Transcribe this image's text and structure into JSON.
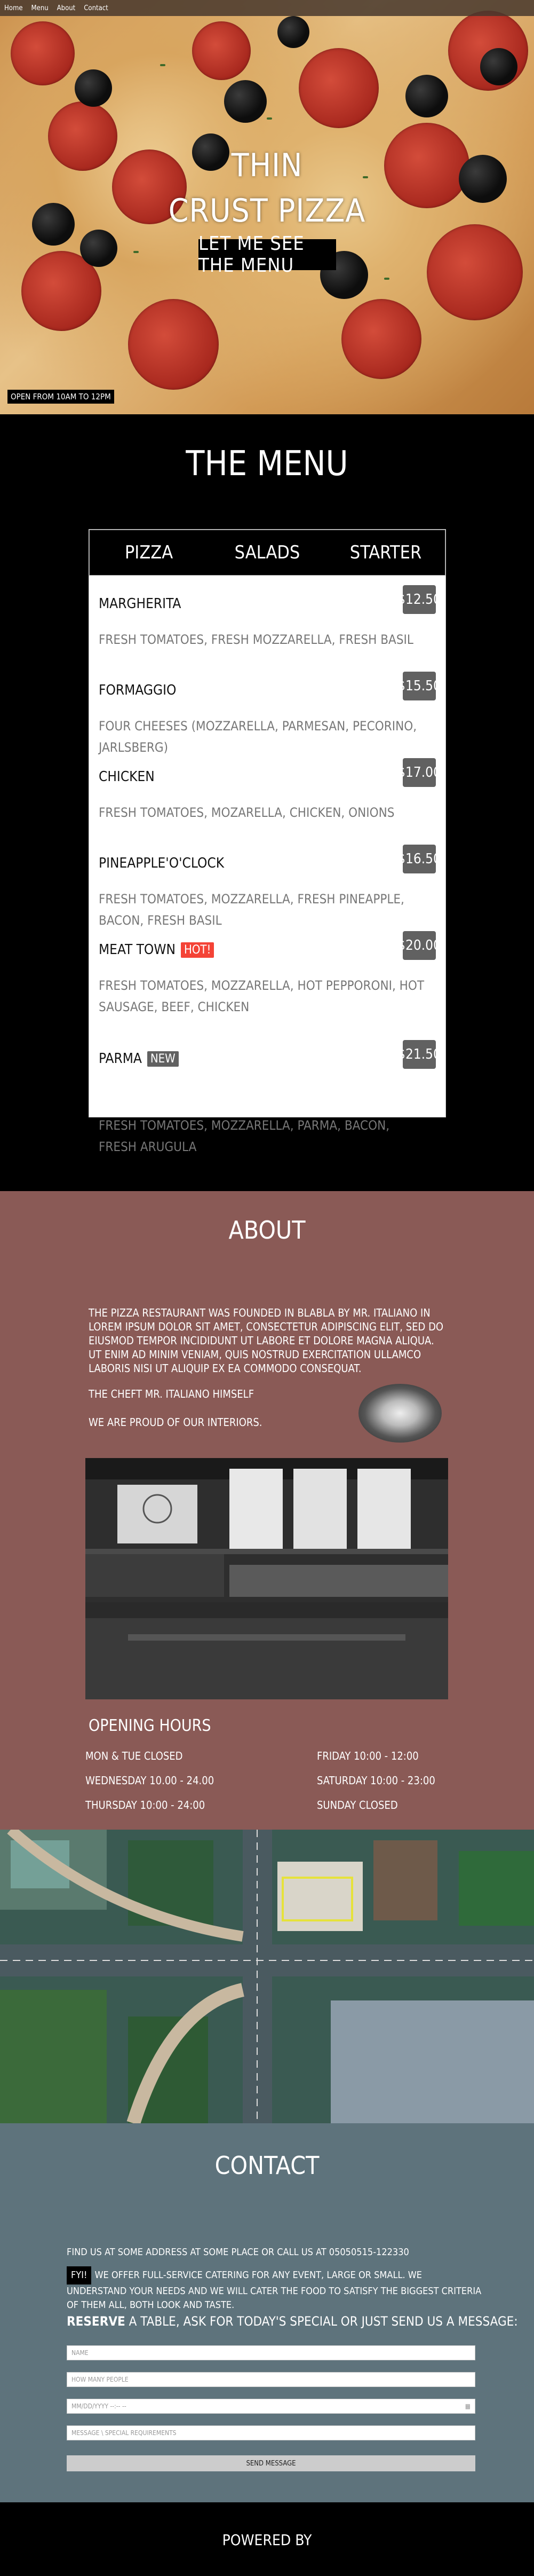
{
  "nav": {
    "items": [
      "Home",
      "Menu",
      "About",
      "Contact"
    ]
  },
  "hero": {
    "title_line1": "THIN",
    "title_line2": "CRUST PIZZA",
    "cta": "LET ME SEE THE MENU",
    "open_hours_badge": "OPEN FROM 10AM TO 12PM"
  },
  "menu": {
    "title": "THE MENU",
    "tabs": [
      "PIZZA",
      "SALADS",
      "STARTER"
    ],
    "items": [
      {
        "name": "MARGHERITA",
        "tag": "",
        "price": "$12.50",
        "desc": "FRESH TOMATOES, FRESH MOZZARELLA, FRESH BASIL"
      },
      {
        "name": "FORMAGGIO",
        "tag": "",
        "price": "$15.50",
        "desc": "FOUR CHEESES (MOZZARELLA, PARMESAN, PECORINO, JARLSBERG)"
      },
      {
        "name": "CHICKEN",
        "tag": "",
        "price": "$17.00",
        "desc": "FRESH TOMATOES, MOZARELLA, CHICKEN, ONIONS"
      },
      {
        "name": "PINEAPPLE'O'CLOCK",
        "tag": "",
        "price": "$16.50",
        "desc": "FRESH TOMATOES, MOZZARELLA, FRESH PINEAPPLE, BACON, FRESH BASIL"
      },
      {
        "name": "MEAT TOWN",
        "tag": "HOT!",
        "price": "$20.00",
        "desc": "FRESH TOMATOES, MOZZARELLA, HOT PEPPORONI, HOT SAUSAGE, BEEF, CHICKEN"
      },
      {
        "name": "PARMA",
        "tag": "NEW",
        "price": "$21.50",
        "desc": "FRESH TOMATOES, MOZZARELLA, PARMA, BACON, FRESH ARUGULA"
      }
    ]
  },
  "about": {
    "title": "ABOUT",
    "paragraph": "THE PIZZA RESTAURANT WAS FOUNDED IN BLABLA BY MR. ITALIANO IN LOREM IPSUM DOLOR SIT AMET, CONSECTETUR ADIPISCING ELIT, SED DO EIUSMOD TEMPOR INCIDIDUNT UT LABORE ET DOLORE MAGNA ALIQUA. UT ENIM AD MINIM VENIAM, QUIS NOSTRUD EXERCITATION ULLAMCO LABORIS NISI UT ALIQUIP EX EA COMMODO CONSEQUAT.",
    "chef": "THE CHEFT MR. ITALIANO HIMSELF",
    "proud": "WE ARE PROUD OF OUR INTERIORS.",
    "hours_title": "OPENING HOURS",
    "hours_left": [
      "MON & TUE CLOSED",
      "WEDNESDAY 10.00 - 24.00",
      "THURSDAY 10:00 - 24:00"
    ],
    "hours_right": [
      "FRIDAY 10:00 - 12:00",
      "SATURDAY 10:00 - 23:00",
      "SUNDAY CLOSED"
    ]
  },
  "contact": {
    "title": "CONTACT",
    "line1": "FIND US AT SOME ADDRESS AT SOME PLACE OR CALL US AT 05050515-122330",
    "fyi_badge": "FYI!",
    "line2": "WE OFFER FULL-SERVICE CATERING FOR ANY EVENT, LARGE OR SMALL. WE UNDERSTAND YOUR NEEDS AND WE WILL CATER THE FOOD TO SATISFY THE BIGGEST CRITERIA OF THEM ALL, BOTH LOOK AND TASTE.",
    "reserve_bold": "RESERVE",
    "reserve_rest": " A TABLE, ASK FOR TODAY'S SPECIAL OR JUST SEND US A MESSAGE:",
    "placeholders": [
      "NAME",
      "HOW MANY PEOPLE",
      "MM/DD/YYYY --:-- --",
      "MESSAGE \\ SPECIAL REQUIREMENTS"
    ],
    "send": "SEND MESSAGE"
  },
  "footer": {
    "text": "POWERED BY"
  }
}
